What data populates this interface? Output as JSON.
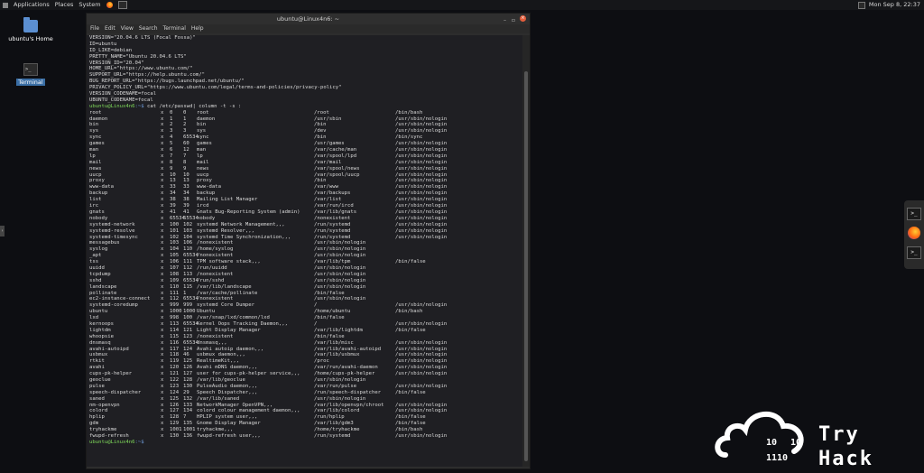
{
  "topbar": {
    "applications": "Applications",
    "places": "Places",
    "system": "System",
    "datetime": "Mon Sep  8, 22:37"
  },
  "desktop": {
    "home_label": "ubuntu's Home",
    "terminal_label": "Terminal"
  },
  "window": {
    "title": "ubuntu@Linux4n6: ~",
    "menu": [
      "File",
      "Edit",
      "View",
      "Search",
      "Terminal",
      "Help"
    ]
  },
  "terminal": {
    "os_release": [
      "VERSION=\"20.04.6 LTS (Focal Fossa)\"",
      "ID=ubuntu",
      "ID_LIKE=debian",
      "PRETTY_NAME=\"Ubuntu 20.04.6 LTS\"",
      "VERSION_ID=\"20.04\"",
      "HOME_URL=\"https://www.ubuntu.com/\"",
      "SUPPORT_URL=\"https://help.ubuntu.com/\"",
      "BUG_REPORT_URL=\"https://bugs.launchpad.net/ubuntu/\"",
      "PRIVACY_POLICY_URL=\"https://www.ubuntu.com/legal/terms-and-policies/privacy-policy\"",
      "VERSION_CODENAME=focal",
      "UBUNTU_CODENAME=focal"
    ],
    "prompt_user": "ubuntu@Linux4n6",
    "prompt_path": ":~$",
    "command": " cat /etc/passwd| column -t -s :",
    "passwd_rows": [
      [
        "root",
        "x",
        "0",
        "0",
        "root",
        "/root",
        "/bin/bash"
      ],
      [
        "daemon",
        "x",
        "1",
        "1",
        "daemon",
        "/usr/sbin",
        "/usr/sbin/nologin"
      ],
      [
        "bin",
        "x",
        "2",
        "2",
        "bin",
        "/bin",
        "/usr/sbin/nologin"
      ],
      [
        "sys",
        "x",
        "3",
        "3",
        "sys",
        "/dev",
        "/usr/sbin/nologin"
      ],
      [
        "sync",
        "x",
        "4",
        "65534",
        "sync",
        "/bin",
        "/bin/sync"
      ],
      [
        "games",
        "x",
        "5",
        "60",
        "games",
        "/usr/games",
        "/usr/sbin/nologin"
      ],
      [
        "man",
        "x",
        "6",
        "12",
        "man",
        "/var/cache/man",
        "/usr/sbin/nologin"
      ],
      [
        "lp",
        "x",
        "7",
        "7",
        "lp",
        "/var/spool/lpd",
        "/usr/sbin/nologin"
      ],
      [
        "mail",
        "x",
        "8",
        "8",
        "mail",
        "/var/mail",
        "/usr/sbin/nologin"
      ],
      [
        "news",
        "x",
        "9",
        "9",
        "news",
        "/var/spool/news",
        "/usr/sbin/nologin"
      ],
      [
        "uucp",
        "x",
        "10",
        "10",
        "uucp",
        "/var/spool/uucp",
        "/usr/sbin/nologin"
      ],
      [
        "proxy",
        "x",
        "13",
        "13",
        "proxy",
        "/bin",
        "/usr/sbin/nologin"
      ],
      [
        "www-data",
        "x",
        "33",
        "33",
        "www-data",
        "/var/www",
        "/usr/sbin/nologin"
      ],
      [
        "backup",
        "x",
        "34",
        "34",
        "backup",
        "/var/backups",
        "/usr/sbin/nologin"
      ],
      [
        "list",
        "x",
        "38",
        "38",
        "Mailing List Manager",
        "/var/list",
        "/usr/sbin/nologin"
      ],
      [
        "irc",
        "x",
        "39",
        "39",
        "ircd",
        "/var/run/ircd",
        "/usr/sbin/nologin"
      ],
      [
        "gnats",
        "x",
        "41",
        "41",
        "Gnats Bug-Reporting System (admin)",
        "/var/lib/gnats",
        "/usr/sbin/nologin"
      ],
      [
        "nobody",
        "x",
        "65534",
        "65534",
        "nobody",
        "/nonexistent",
        "/usr/sbin/nologin"
      ],
      [
        "systemd-network",
        "x",
        "100",
        "102",
        "systemd Network Management,,,",
        "/run/systemd",
        "/usr/sbin/nologin"
      ],
      [
        "systemd-resolve",
        "x",
        "101",
        "103",
        "systemd Resolver,,,",
        "/run/systemd",
        "/usr/sbin/nologin"
      ],
      [
        "systemd-timesync",
        "x",
        "102",
        "104",
        "systemd Time Synchronization,,,",
        "/run/systemd",
        "/usr/sbin/nologin"
      ],
      [
        "messagebus",
        "x",
        "103",
        "106",
        "/nonexistent",
        "/usr/sbin/nologin",
        ""
      ],
      [
        "syslog",
        "x",
        "104",
        "110",
        "/home/syslog",
        "/usr/sbin/nologin",
        ""
      ],
      [
        "_apt",
        "x",
        "105",
        "65534",
        "/nonexistent",
        "/usr/sbin/nologin",
        ""
      ],
      [
        "tss",
        "x",
        "106",
        "111",
        "TPM software stack,,,",
        "/var/lib/tpm",
        "/bin/false"
      ],
      [
        "uuidd",
        "x",
        "107",
        "112",
        "/run/uuidd",
        "/usr/sbin/nologin",
        ""
      ],
      [
        "tcpdump",
        "x",
        "108",
        "113",
        "/nonexistent",
        "/usr/sbin/nologin",
        ""
      ],
      [
        "sshd",
        "x",
        "109",
        "65534",
        "/run/sshd",
        "/usr/sbin/nologin",
        ""
      ],
      [
        "landscape",
        "x",
        "110",
        "115",
        "/var/lib/landscape",
        "/usr/sbin/nologin",
        ""
      ],
      [
        "pollinate",
        "x",
        "111",
        "1",
        "/var/cache/pollinate",
        "/bin/false",
        ""
      ],
      [
        "ec2-instance-connect",
        "x",
        "112",
        "65534",
        "/nonexistent",
        "/usr/sbin/nologin",
        ""
      ],
      [
        "systemd-coredump",
        "x",
        "999",
        "999",
        "systemd Core Dumper",
        "/",
        "/usr/sbin/nologin"
      ],
      [
        "ubuntu",
        "x",
        "1000",
        "1000",
        "Ubuntu",
        "/home/ubuntu",
        "/bin/bash"
      ],
      [
        "lxd",
        "x",
        "998",
        "100",
        "/var/snap/lxd/common/lxd",
        "/bin/false",
        ""
      ],
      [
        "kernoops",
        "x",
        "113",
        "65534",
        "Kernel Oops Tracking Daemon,,,",
        "/",
        "/usr/sbin/nologin"
      ],
      [
        "lightdm",
        "x",
        "114",
        "121",
        "Light Display Manager",
        "/var/lib/lightdm",
        "/bin/false"
      ],
      [
        "whoopsie",
        "x",
        "115",
        "123",
        "/nonexistent",
        "/bin/false",
        ""
      ],
      [
        "dnsmasq",
        "x",
        "116",
        "65534",
        "dnsmasq,,,",
        "/var/lib/misc",
        "/usr/sbin/nologin"
      ],
      [
        "avahi-autoipd",
        "x",
        "117",
        "124",
        "Avahi autoip daemon,,,",
        "/var/lib/avahi-autoipd",
        "/usr/sbin/nologin"
      ],
      [
        "usbmux",
        "x",
        "118",
        "46",
        "usbmux daemon,,,",
        "/var/lib/usbmux",
        "/usr/sbin/nologin"
      ],
      [
        "rtkit",
        "x",
        "119",
        "125",
        "RealtimeKit,,,",
        "/proc",
        "/usr/sbin/nologin"
      ],
      [
        "avahi",
        "x",
        "120",
        "126",
        "Avahi mDNS daemon,,,",
        "/var/run/avahi-daemon",
        "/usr/sbin/nologin"
      ],
      [
        "cups-pk-helper",
        "x",
        "121",
        "127",
        "user for cups-pk-helper service,,,",
        "/home/cups-pk-helper",
        "/usr/sbin/nologin"
      ],
      [
        "geoclue",
        "x",
        "122",
        "128",
        "/var/lib/geoclue",
        "/usr/sbin/nologin",
        ""
      ],
      [
        "pulse",
        "x",
        "123",
        "130",
        "PulseAudio daemon,,,",
        "/var/run/pulse",
        "/usr/sbin/nologin"
      ],
      [
        "speech-dispatcher",
        "x",
        "124",
        "29",
        "Speech Dispatcher,,,",
        "/run/speech-dispatcher",
        "/bin/false"
      ],
      [
        "saned",
        "x",
        "125",
        "132",
        "/var/lib/saned",
        "/usr/sbin/nologin",
        ""
      ],
      [
        "nm-openvpn",
        "x",
        "126",
        "133",
        "NetworkManager OpenVPN,,,",
        "/var/lib/openvpn/chroot",
        "/usr/sbin/nologin"
      ],
      [
        "colord",
        "x",
        "127",
        "134",
        "colord colour management daemon,,,",
        "/var/lib/colord",
        "/usr/sbin/nologin"
      ],
      [
        "hplip",
        "x",
        "128",
        "7",
        "HPLIP system user,,,",
        "/run/hplip",
        "/bin/false"
      ],
      [
        "gdm",
        "x",
        "129",
        "135",
        "Gnome Display Manager",
        "/var/lib/gdm3",
        "/bin/false"
      ],
      [
        "tryhackme",
        "x",
        "1001",
        "1001",
        "tryhackme,,,",
        "/home/tryhackme",
        "/bin/bash"
      ],
      [
        "fwupd-refresh",
        "x",
        "130",
        "136",
        "fwupd-refresh user,,,",
        "/run/systemd",
        "/usr/sbin/nologin"
      ]
    ],
    "final_prompt_user": "ubuntu@Linux4n6",
    "final_prompt_path": ":~$"
  },
  "logo": {
    "line1": "Try",
    "line2": "Hack",
    "bin_a": "10",
    "bin_b": "10",
    "bin_c": "1110"
  },
  "icons": {
    "firefox": "firefox-icon",
    "terminal": "terminal-icon",
    "folder": "folder-icon"
  }
}
